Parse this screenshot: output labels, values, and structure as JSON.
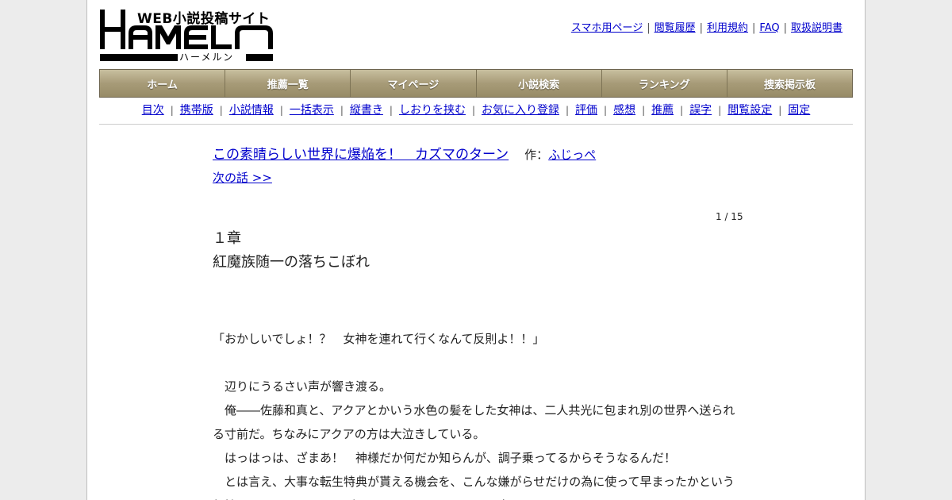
{
  "logo": {
    "tagline": "WEB小説投稿サイト",
    "wordmark": "HAMELN",
    "kana": "ハーメルン"
  },
  "top_links": [
    "スマホ用ページ",
    "閲覧履歴",
    "利用規約",
    "FAQ",
    "取扱説明書"
  ],
  "main_nav": [
    "ホーム",
    "推薦一覧",
    "マイページ",
    "小説検索",
    "ランキング",
    "捜索掲示板"
  ],
  "sub_nav": [
    "目次",
    "携帯版",
    "小説情報",
    "一括表示",
    "縦書き",
    "しおりを挟む",
    "お気に入り登録",
    "評価",
    "感想",
    "推薦",
    "誤字",
    "閲覧設定",
    "固定"
  ],
  "novel": {
    "title": "この素晴らしい世界に爆焔を！　カズマのターン",
    "author_label": "作：",
    "author": "ふじっぺ",
    "next": "次の話 >>",
    "pager": "1 / 15"
  },
  "chapter": {
    "number": "１章",
    "title": "紅魔族随一の落ちこぼれ"
  },
  "body": [
    "「おかしいでしょ！？　女神を連れて行くなんて反則よ！！」",
    "",
    "　辺りにうるさい声が響き渡る。",
    "　俺――佐藤和真と、アクアとかいう水色の髪をした女神は、二人共光に包まれ別の世界へ送られる寸前だ。ちなみにアクアの方は大泣きしている。",
    "　はっはっは、ざまあ！　神様だか何だか知らんが、調子乗ってるからそうなるんだ！",
    "　とは言え、大事な転生特典が貰える機会を、こんな嫌がらせだけの為に使って早まったかという気持ちもなくはないのだが、まぁ、スッキリしたので良しとしよう。"
  ],
  "colors": {
    "nav_top": "#c8bf9f",
    "nav_bottom": "#978b66",
    "link": "#0000cc",
    "page_bg": "#ececec"
  }
}
